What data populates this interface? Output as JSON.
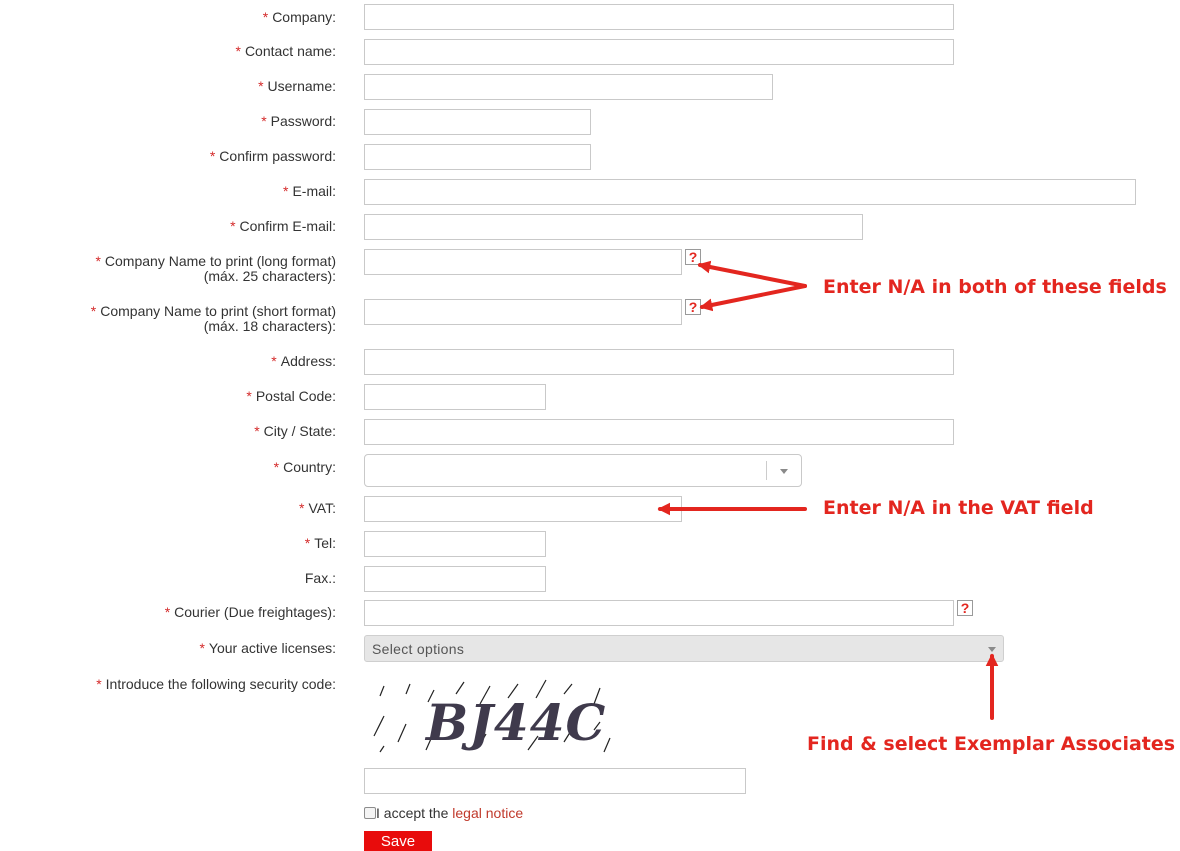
{
  "form": {
    "required_marker": "*",
    "company_label": "Company:",
    "contact_label": "Contact name:",
    "username_label": "Username:",
    "password_label": "Password:",
    "confirm_password_label": "Confirm password:",
    "email_label": "E-mail:",
    "confirm_email_label": "Confirm E-mail:",
    "print_long_label_line1": "Company Name to print (long format)",
    "print_long_label_line2": "(máx. 25 characters):",
    "print_short_label_line1": "Company Name to print (short format)",
    "print_short_label_line2": "(máx. 18 characters):",
    "address_label": "Address:",
    "postal_label": "Postal Code:",
    "city_label": "City / State:",
    "country_label": "Country:",
    "vat_label": "VAT:",
    "tel_label": "Tel:",
    "fax_label": "Fax.:",
    "courier_label": "Courier (Due freightages):",
    "licenses_label": "Your active licenses:",
    "licenses_placeholder": "Select options",
    "security_label": "Introduce the following security code:",
    "captcha_text": "BJ44C",
    "help_glyph": "?",
    "accept_text": "I accept the",
    "legal_link": "legal notice",
    "save_label": "Save"
  },
  "annotations": {
    "print_names_note": "Enter N/A in both of these fields",
    "vat_note": "Enter N/A in the VAT field",
    "licenses_note": "Find & select Exemplar Associates"
  },
  "colors": {
    "required": "#d42a2a",
    "annotation": "#e3261f",
    "save_button": "#e80c0c",
    "link": "#c0392b"
  }
}
